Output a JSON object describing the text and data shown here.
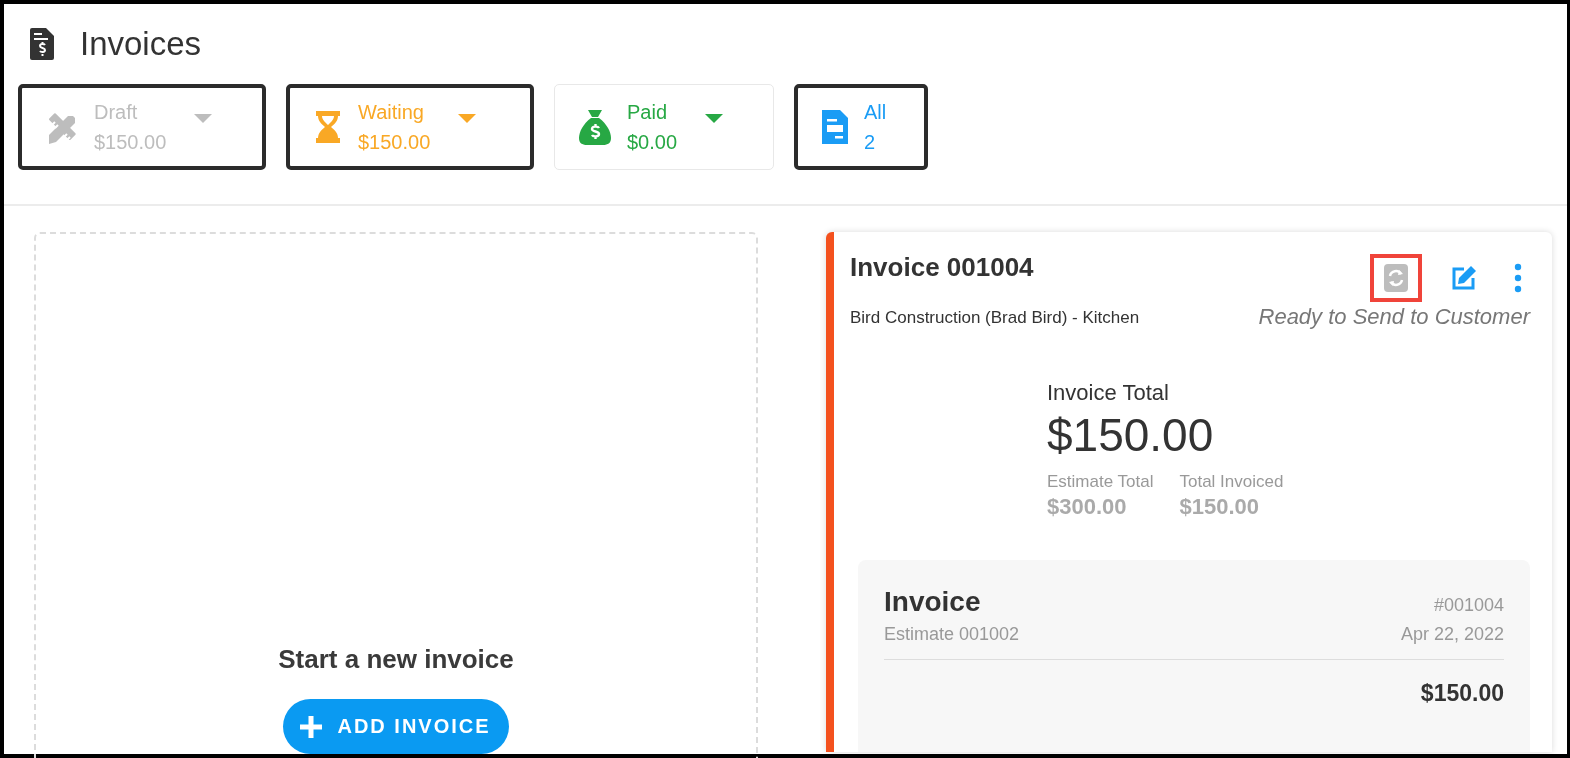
{
  "page": {
    "title": "Invoices"
  },
  "filters": [
    {
      "kind": "draft",
      "label": "Draft",
      "value": "$150.00",
      "color": "#bdbdbd",
      "highlighted": true,
      "dropdown": true
    },
    {
      "kind": "waiting",
      "label": "Waiting",
      "value": "$150.00",
      "color": "#f9a825",
      "highlighted": true,
      "dropdown": true
    },
    {
      "kind": "paid",
      "label": "Paid",
      "value": "$0.00",
      "color": "#27a844",
      "highlighted": false,
      "dropdown": true
    },
    {
      "kind": "all",
      "label": "All",
      "value": "2",
      "color": "#1a9cf5",
      "highlighted": true,
      "dropdown": false
    }
  ],
  "new_invoice": {
    "heading": "Start a new invoice",
    "button": "ADD INVOICE"
  },
  "invoice_card": {
    "title": "Invoice 001004",
    "customer": "Bird Construction (Brad Bird) - Kitchen",
    "status": "Ready to Send to Customer",
    "actions": [
      {
        "kind": "sync",
        "highlighted": true
      },
      {
        "kind": "edit",
        "highlighted": false
      },
      {
        "kind": "more",
        "highlighted": false
      }
    ],
    "total_label": "Invoice Total",
    "total": "$150.00",
    "estimate_total_label": "Estimate Total",
    "estimate_total": "$300.00",
    "total_invoiced_label": "Total Invoiced",
    "total_invoiced": "$150.00",
    "document": {
      "title": "Invoice",
      "number": "#001004",
      "source": "Estimate 001002",
      "date": "Apr 22, 2022",
      "amount": "$150.00"
    }
  }
}
